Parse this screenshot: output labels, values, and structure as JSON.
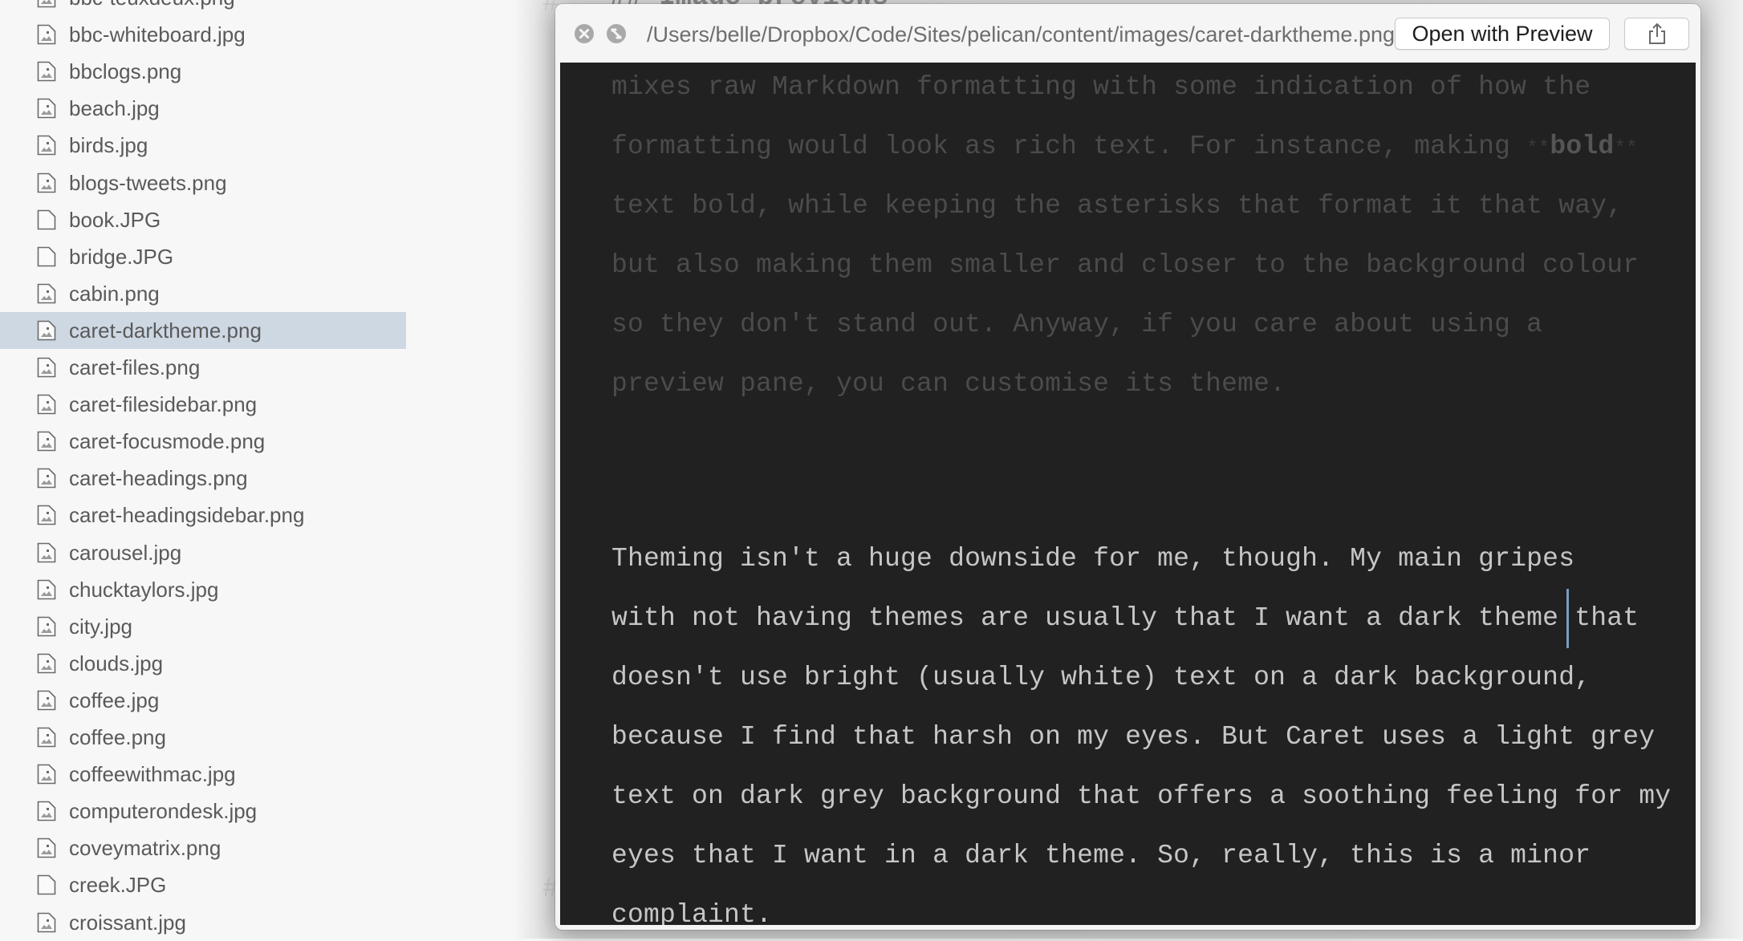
{
  "sidebar": {
    "files": [
      {
        "name": "bbc-teuxdeux.png",
        "type": "image"
      },
      {
        "name": "bbc-whiteboard.jpg",
        "type": "image"
      },
      {
        "name": "bbclogs.png",
        "type": "image"
      },
      {
        "name": "beach.jpg",
        "type": "image"
      },
      {
        "name": "birds.jpg",
        "type": "image"
      },
      {
        "name": "blogs-tweets.png",
        "type": "image"
      },
      {
        "name": "book.JPG",
        "type": "blank"
      },
      {
        "name": "bridge.JPG",
        "type": "blank"
      },
      {
        "name": "cabin.png",
        "type": "image"
      },
      {
        "name": "caret-darktheme.png",
        "type": "image",
        "selected": true
      },
      {
        "name": "caret-files.png",
        "type": "image"
      },
      {
        "name": "caret-filesidebar.png",
        "type": "image"
      },
      {
        "name": "caret-focusmode.png",
        "type": "image"
      },
      {
        "name": "caret-headings.png",
        "type": "image"
      },
      {
        "name": "caret-headingsidebar.png",
        "type": "image"
      },
      {
        "name": "carousel.jpg",
        "type": "image"
      },
      {
        "name": "chucktaylors.jpg",
        "type": "image"
      },
      {
        "name": "city.jpg",
        "type": "image"
      },
      {
        "name": "clouds.jpg",
        "type": "image"
      },
      {
        "name": "coffee.jpg",
        "type": "image"
      },
      {
        "name": "coffee.png",
        "type": "image"
      },
      {
        "name": "coffeewithmac.jpg",
        "type": "image"
      },
      {
        "name": "computerondesk.jpg",
        "type": "image"
      },
      {
        "name": "coveymatrix.png",
        "type": "image"
      },
      {
        "name": "creek.JPG",
        "type": "blank"
      },
      {
        "name": "croissant.jpg",
        "type": "image"
      }
    ],
    "selected_color": "#cdd8e3"
  },
  "background_editor": {
    "heading": "## Image previews",
    "hash_mark": "#"
  },
  "quicklook": {
    "path": "/Users/belle/Dropbox/Code/Sites/pelican/content/images/caret-darktheme.png",
    "open_button_label": "Open with Preview",
    "close_icon": "close-circle-icon",
    "fullscreen_icon": "fullscreen-circle-icon",
    "share_icon": "share-icon",
    "preview": {
      "background": "#212121",
      "caret_color": "#7b9cc4",
      "faded_lines": [
        {
          "text": "mixes raw Markdown formatting with some indication of how the"
        },
        {
          "before": "formatting would look as rich text. For instance, making ",
          "mark_open": "**",
          "bold": "bold",
          "mark_close": "**"
        },
        {
          "text": "text bold, while keeping the asterisks that format it that way,"
        },
        {
          "text": "but also making them smaller and closer to the background colour"
        },
        {
          "text": "so they don't stand out. Anyway, if you care about using a"
        },
        {
          "text": "preview pane, you can customise its theme."
        }
      ],
      "bright_lines": [
        "Theming isn't a huge downside for me, though. My main gripes",
        "with not having themes are usually that I want a dark theme that",
        "doesn't use bright (usually white) text on a dark background,",
        "because I find that harsh on my eyes. But Caret uses a light grey",
        "text on dark grey background that offers a soothing feeling for my",
        "eyes that I want in a dark theme. So, really, this is a minor",
        "complaint."
      ]
    }
  }
}
